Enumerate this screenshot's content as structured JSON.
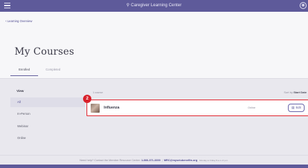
{
  "topbar": {
    "brand_icon": "map-pin-icon",
    "title": "Caregiver Learning Center",
    "menu_icon": "hamburger-menu-icon",
    "account_icon": "user-icon"
  },
  "header": {
    "breadcrumb": "Learning Overview",
    "title": "My Courses",
    "tabs": [
      {
        "label": "Enrolled",
        "active": true
      },
      {
        "label": "Completed",
        "active": false
      }
    ]
  },
  "sidebar": {
    "view_label": "View",
    "filters": [
      {
        "label": "All",
        "active": true
      },
      {
        "label": "In-Person",
        "active": false
      },
      {
        "label": "Webinar",
        "active": false
      },
      {
        "label": "Online",
        "active": false
      }
    ]
  },
  "main": {
    "count": "1 course",
    "sort_prefix": "Sort by",
    "sort_value": "Start Date",
    "courses": [
      {
        "badge": "2",
        "name": "Influenza",
        "type": "Online",
        "edit_label": "Edit",
        "edit_icon": "calendar-icon"
      }
    ]
  },
  "footer": {
    "help_prefix": "Need help?",
    "help_text": "Contact the Member Resource Center:",
    "phone": "1-866-371-3300",
    "email": "MRC@myseiubenefits.org",
    "hours": "Monday to Friday 8 a.m.-6 p.m."
  },
  "colors": {
    "brand": "#5e5a9a",
    "highlight_border": "#e0202a",
    "badge": "#d8202a"
  }
}
